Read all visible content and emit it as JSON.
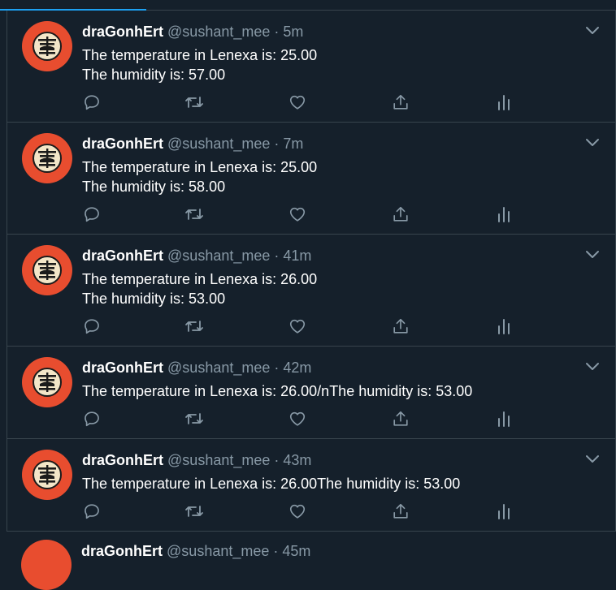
{
  "colors": {
    "background": "#15202b",
    "border": "#38444d",
    "accent": "#1da1f2",
    "muted": "#8899a6",
    "avatar": "#e84d2f"
  },
  "tweets": [
    {
      "name": "draGonhErt",
      "handle": "@sushant_mee",
      "separator": "·",
      "time": "5m",
      "lines": [
        "The temperature in Lenexa is: 25.00",
        "The humidity is: 57.00"
      ]
    },
    {
      "name": "draGonhErt",
      "handle": "@sushant_mee",
      "separator": "·",
      "time": "7m",
      "lines": [
        "The temperature in Lenexa is: 25.00",
        "The humidity is: 58.00"
      ]
    },
    {
      "name": "draGonhErt",
      "handle": "@sushant_mee",
      "separator": "·",
      "time": "41m",
      "lines": [
        "The temperature in Lenexa is: 26.00",
        "The humidity is: 53.00"
      ]
    },
    {
      "name": "draGonhErt",
      "handle": "@sushant_mee",
      "separator": "·",
      "time": "42m",
      "lines": [
        "The temperature in Lenexa is: 26.00/nThe humidity is: 53.00"
      ]
    },
    {
      "name": "draGonhErt",
      "handle": "@sushant_mee",
      "separator": "·",
      "time": "43m",
      "lines": [
        "The temperature in Lenexa is: 26.00The humidity is: 53.00"
      ]
    }
  ],
  "partial_tweet": {
    "name": "draGonhErt",
    "handle": "@sushant_mee",
    "separator": "·",
    "time": "45m"
  },
  "icons": [
    "reply-icon",
    "retweet-icon",
    "like-icon",
    "share-icon",
    "analytics-icon",
    "chevron-down-icon"
  ]
}
